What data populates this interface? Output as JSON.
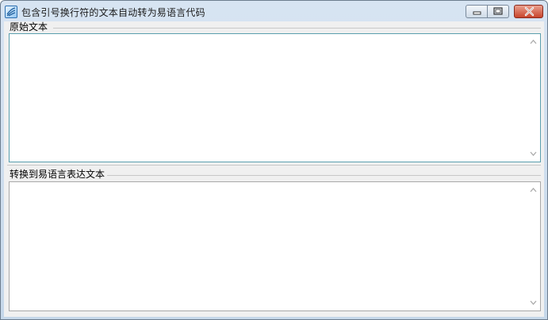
{
  "window": {
    "title": "包含引号换行符的文本自动转为易语言代码",
    "buttons": {
      "minimize": "minimize-icon",
      "maximize": "maximize-icon",
      "close": "close-icon"
    }
  },
  "fields": {
    "original_label": "原始文本",
    "original_value": "",
    "converted_label": "转换到易语言表达文本",
    "converted_value": ""
  }
}
